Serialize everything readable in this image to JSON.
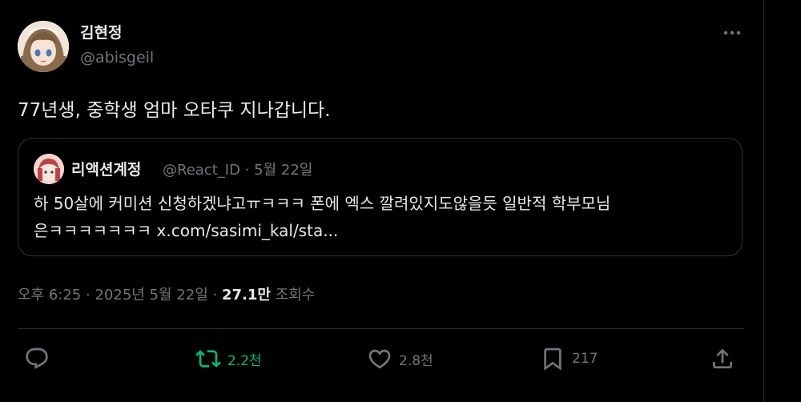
{
  "tweet": {
    "author": {
      "display_name": "김현정",
      "handle": "@abisgeil"
    },
    "text": "77년생, 중학생 엄마 오타쿠 지나갑니다.",
    "quote": {
      "display_name": "리액션계정",
      "handle": "@React_ID",
      "separator": "·",
      "date": "5월 22일",
      "text_line1": "하 50살에 커미션 신청하겠냐고ㅠㅋㅋㅋ 폰에 엑스 깔려있지도않을듯 일반적 학부모님",
      "text_line2": "은ㅋㅋㅋㅋㅋㅋㅋ x.com/sasimi_kal/sta..."
    },
    "meta": {
      "time": "오후 6:25",
      "separator": "·",
      "date": "2025년 5월 22일",
      "separator2": "·",
      "views_count": "27.1만",
      "views_label": "조회수"
    },
    "actions": {
      "reply": {
        "icon": "reply-icon",
        "count": ""
      },
      "retweet": {
        "icon": "retweet-icon",
        "count": "2.2천",
        "color": "#00ba7c"
      },
      "like": {
        "icon": "heart-icon",
        "count": "2.8천"
      },
      "bookmark": {
        "icon": "bookmark-icon",
        "count": "217"
      },
      "share": {
        "icon": "share-icon"
      }
    }
  },
  "colors": {
    "background": "#000000",
    "text": "#e7e9ea",
    "muted": "#71767b",
    "border": "#2f3336",
    "retweet_active": "#00ba7c"
  }
}
